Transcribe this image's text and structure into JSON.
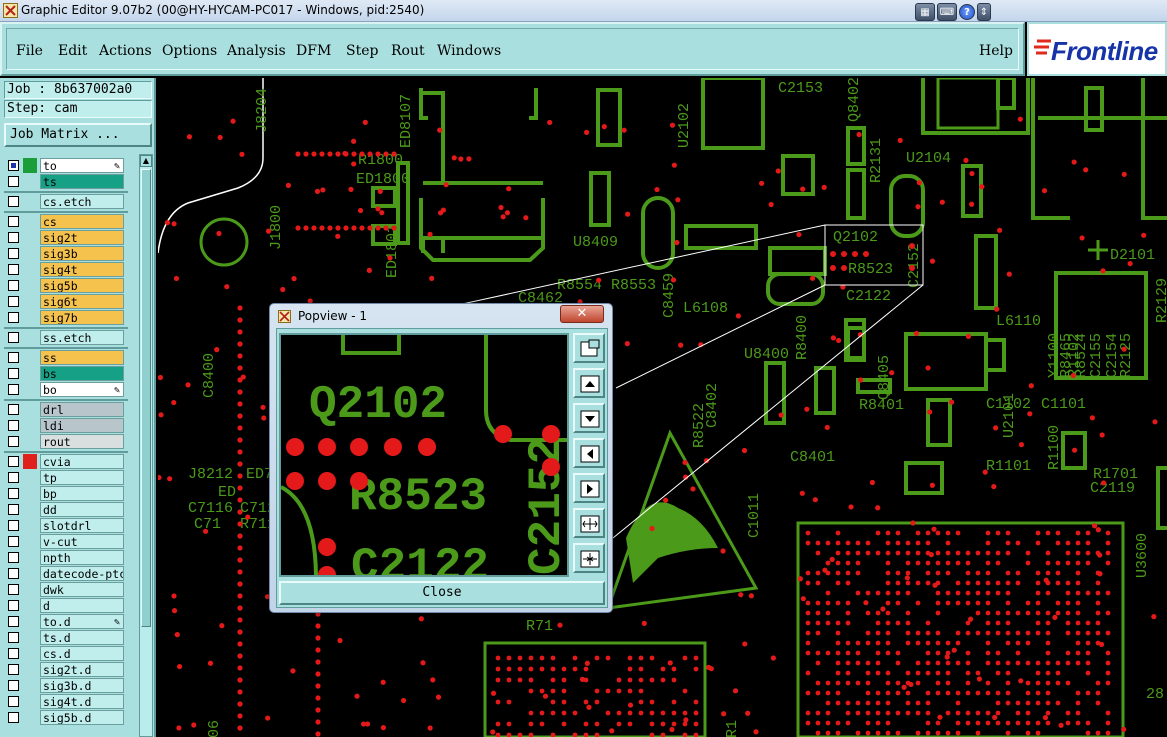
{
  "window": {
    "title": "Graphic Editor 9.07b2 (00@HY-HYCAM-PC017 - Windows, pid:2540)",
    "controls": [
      "keyboard-icon",
      "help-icon",
      "scroll-icon"
    ]
  },
  "menu": {
    "items": [
      "File",
      "Edit",
      "Actions",
      "Options",
      "Analysis",
      "DFM",
      "Step",
      "Rout",
      "Windows"
    ],
    "help": "Help"
  },
  "logo": {
    "text": "Frontline",
    "color": "#1633a8"
  },
  "job": {
    "line": "Job : 8b637002a0",
    "step": "Step: cam",
    "matrix_button": "Job Matrix ..."
  },
  "layers": [
    {
      "name": "to",
      "color": "#ffffff",
      "swatch": "#1b9e3a",
      "checked": true,
      "mark": "pencil-icon"
    },
    {
      "name": "ts",
      "color": "#16a085",
      "swatch": "",
      "checked": false
    },
    {
      "name": "cs.etch",
      "color": "#bfeeed",
      "swatch": "",
      "checked": false
    },
    {
      "name": "cs",
      "color": "#f6c24e",
      "swatch": "",
      "checked": false
    },
    {
      "name": "sig2t",
      "color": "#f6c24e",
      "swatch": "",
      "checked": false
    },
    {
      "name": "sig3b",
      "color": "#f6c24e",
      "swatch": "",
      "checked": false
    },
    {
      "name": "sig4t",
      "color": "#f6c24e",
      "swatch": "",
      "checked": false
    },
    {
      "name": "sig5b",
      "color": "#f6c24e",
      "swatch": "",
      "checked": false
    },
    {
      "name": "sig6t",
      "color": "#f6c24e",
      "swatch": "",
      "checked": false
    },
    {
      "name": "sig7b",
      "color": "#f6c24e",
      "swatch": "",
      "checked": false
    },
    {
      "name": "ss.etch",
      "color": "#bfeeed",
      "swatch": "",
      "checked": false
    },
    {
      "name": "ss",
      "color": "#f6c24e",
      "swatch": "",
      "checked": false
    },
    {
      "name": "bs",
      "color": "#16a085",
      "swatch": "",
      "checked": false
    },
    {
      "name": "bo",
      "color": "#ffffff",
      "swatch": "",
      "checked": false,
      "mark": "pencil-icon"
    },
    {
      "name": "drl",
      "color": "#b8c6cc",
      "swatch": "",
      "checked": false
    },
    {
      "name": "ldi",
      "color": "#b8c6cc",
      "swatch": "",
      "checked": false
    },
    {
      "name": "rout",
      "color": "#d9dedf",
      "swatch": "",
      "checked": false
    },
    {
      "name": "cvia",
      "color": "#bfeeed",
      "swatch": "#e0201b",
      "checked": false
    },
    {
      "name": "tp",
      "color": "#bfeeed",
      "swatch": "",
      "checked": false
    },
    {
      "name": "bp",
      "color": "#bfeeed",
      "swatch": "",
      "checked": false
    },
    {
      "name": "dd",
      "color": "#bfeeed",
      "swatch": "",
      "checked": false
    },
    {
      "name": "slotdrl",
      "color": "#bfeeed",
      "swatch": "",
      "checked": false
    },
    {
      "name": "v-cut",
      "color": "#bfeeed",
      "swatch": "",
      "checked": false
    },
    {
      "name": "npth",
      "color": "#bfeeed",
      "swatch": "",
      "checked": false
    },
    {
      "name": "datecode-ptc",
      "color": "#bfeeed",
      "swatch": "",
      "checked": false
    },
    {
      "name": "dwk",
      "color": "#bfeeed",
      "swatch": "",
      "checked": false
    },
    {
      "name": "d",
      "color": "#bfeeed",
      "swatch": "",
      "checked": false
    },
    {
      "name": "to.d",
      "color": "#bfeeed",
      "swatch": "",
      "checked": false,
      "mark": "pencil-icon"
    },
    {
      "name": "ts.d",
      "color": "#bfeeed",
      "swatch": "",
      "checked": false
    },
    {
      "name": "cs.d",
      "color": "#bfeeed",
      "swatch": "",
      "checked": false
    },
    {
      "name": "sig2t.d",
      "color": "#bfeeed",
      "swatch": "",
      "checked": false
    },
    {
      "name": "sig3b.d",
      "color": "#bfeeed",
      "swatch": "",
      "checked": false
    },
    {
      "name": "sig4t.d",
      "color": "#bfeeed",
      "swatch": "",
      "checked": false
    },
    {
      "name": "sig5b.d",
      "color": "#bfeeed",
      "swatch": "",
      "checked": false
    }
  ],
  "canvas_labels": {
    "refdes": [
      "J8204",
      "ED8107",
      "R1800",
      "ED1800",
      "J1800",
      "ED1801",
      "U2102",
      "C2153",
      "Q8402",
      "R2131",
      "U2104",
      "U8409",
      "Q2102",
      "R8523",
      "C2122",
      "C2152",
      "R8554",
      "R8553",
      "C8459",
      "L6108",
      "C8462",
      "D2101",
      "L6110",
      "U8400",
      "R8400",
      "Q8405",
      "R8401",
      "C1102",
      "C1101",
      "Y1100",
      "R1102",
      "R8465",
      "R8524",
      "C2155",
      "C2154",
      "R2125",
      "R2129",
      "U2101",
      "R1101",
      "R1100",
      "R1701",
      "C2119",
      "R8522",
      "C8402",
      "C8401",
      "C8400",
      "J8212",
      "ED7104",
      "ED",
      "C7116",
      "C7120",
      "C71",
      "R7118",
      "R71",
      "U3600",
      "C1011",
      "28",
      "R1",
      "06",
      "300"
    ]
  },
  "popview": {
    "title": "Popview - 1",
    "close_label": "Close",
    "labels": [
      "Q2102",
      "R8523",
      "C2122",
      "C2152"
    ],
    "tools": [
      "zoom-fit-icon",
      "pan-up-icon",
      "pan-down-icon",
      "pan-left-icon",
      "pan-right-icon",
      "zoom-in-icon",
      "zoom-out-icon"
    ]
  },
  "colors": {
    "trace": "#4c9a1a",
    "pad": "#e41a1a",
    "board_bg": "#000000",
    "panel": "#a9e0df"
  }
}
